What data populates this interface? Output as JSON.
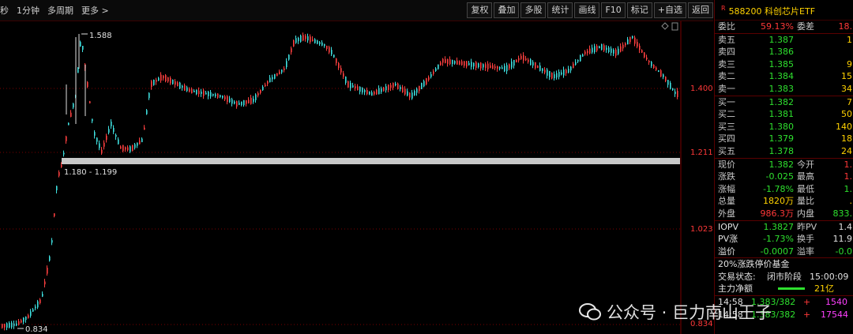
{
  "toolbar": {
    "left": [
      "秒",
      "1分钟",
      "多周期",
      "更多 >"
    ],
    "buttons": [
      "复权",
      "叠加",
      "多股",
      "统计",
      "画线",
      "F10",
      "标记",
      "+自选",
      "返回"
    ]
  },
  "chart": {
    "y_labels": [
      "1.400",
      "1.211",
      "1.023",
      "0.834"
    ],
    "high_label": "1.588",
    "low_label": "0.834",
    "band_label": "1.180 - 1.199"
  },
  "quote": {
    "header_flag": "R",
    "header": "588200 科创芯片ETF",
    "wb": {
      "l1": "委比",
      "v1": "59.13%",
      "l2": "委差",
      "v2": "18."
    },
    "asks": [
      {
        "label": "卖五",
        "price": "1.387",
        "vol": "1"
      },
      {
        "label": "卖四",
        "price": "1.386",
        "vol": ""
      },
      {
        "label": "卖三",
        "price": "1.385",
        "vol": "9"
      },
      {
        "label": "卖二",
        "price": "1.384",
        "vol": "15"
      },
      {
        "label": "卖一",
        "price": "1.383",
        "vol": "34"
      }
    ],
    "bids": [
      {
        "label": "买一",
        "price": "1.382",
        "vol": "7"
      },
      {
        "label": "买二",
        "price": "1.381",
        "vol": "50"
      },
      {
        "label": "买三",
        "price": "1.380",
        "vol": "140"
      },
      {
        "label": "买四",
        "price": "1.379",
        "vol": "18"
      },
      {
        "label": "买五",
        "price": "1.378",
        "vol": "24"
      }
    ],
    "stats": [
      {
        "l1": "现价",
        "v1": "1.382",
        "l2": "今开",
        "v2": "1."
      },
      {
        "l1": "涨跌",
        "v1": "-0.025",
        "l2": "最高",
        "v2": "1."
      },
      {
        "l1": "涨幅",
        "v1": "-1.78%",
        "l2": "最低",
        "v2": "1."
      },
      {
        "l1": "总量",
        "v1": "1820万",
        "l2": "量比",
        "v2": "."
      },
      {
        "l1": "外盘",
        "v1": "986.3万",
        "l2": "内盘",
        "v2": "833."
      }
    ],
    "iopv": [
      {
        "l1": "IOPV",
        "v1": "1.3827",
        "l2": "昨PV",
        "v2": "1.4"
      },
      {
        "l1": "PV涨",
        "v1": "-1.73%",
        "l2": "换手",
        "v2": "11.9"
      },
      {
        "l1": "溢价",
        "v1": "-0.0007",
        "l2": "溢率",
        "v2": "-0.0"
      }
    ],
    "limit_text": "20%涨跌停价基金",
    "trade_status_label": "交易状态:",
    "trade_status": "闭市阶段",
    "trade_time": "15:00:09",
    "main_net_label": "主力净额",
    "main_net_value": "21亿",
    "ticks": [
      {
        "time": "14:58",
        "price": "1.383/382",
        "sign": "+",
        "vol": "1540"
      },
      {
        "time": "14:58",
        "price": "1.383/382",
        "sign": "+",
        "vol": "17544"
      }
    ]
  },
  "watermark": {
    "text": "公众号 · 巨力南山王子"
  }
}
